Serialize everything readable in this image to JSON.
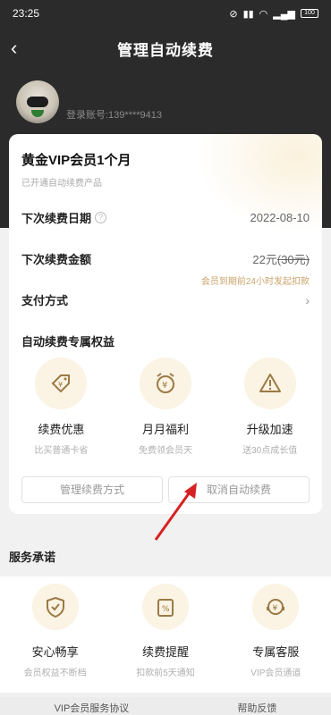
{
  "status_bar": {
    "time": "23:25",
    "battery": "100"
  },
  "nav": {
    "title": "管理自动续费",
    "back_icon": "chevron-left-icon"
  },
  "profile": {
    "account": "登录账号:139****9413"
  },
  "plan": {
    "title": "黄金VIP会员1个月",
    "subtitle": "已开通自动续费产品",
    "next_date_label": "下次续费日期",
    "next_date_value": "2022-08-10",
    "next_amount_label": "下次续费金额",
    "next_amount_value": "22元",
    "next_amount_original": "(30元)",
    "amount_note": "会员到期前24小时发起扣款",
    "payment_label": "支付方式",
    "benefits_title": "自动续费专属权益",
    "benefits": [
      {
        "icon": "discount-tag-icon",
        "name": "续费优惠",
        "desc": "比买普通卡省"
      },
      {
        "icon": "alarm-clock-yen-icon",
        "name": "月月福利",
        "desc": "免费领会员天"
      },
      {
        "icon": "warning-speed-icon",
        "name": "升级加速",
        "desc": "送30点成长值"
      }
    ],
    "manage_button": "管理续费方式",
    "cancel_button": "取消自动续费"
  },
  "promise": {
    "title": "服务承诺",
    "items": [
      {
        "icon": "shield-check-icon",
        "name": "安心畅享",
        "desc": "会员权益不断档"
      },
      {
        "icon": "calendar-percent-icon",
        "name": "续费提醒",
        "desc": "扣款前5天通知"
      },
      {
        "icon": "headset-yen-icon",
        "name": "专属客服",
        "desc": "VIP会员通道"
      }
    ]
  },
  "footer": {
    "left": "VIP会员服务协议",
    "right": "帮助反馈"
  },
  "colors": {
    "header": "#2b2b2b",
    "gold": "#c9a46a",
    "arrow": "#d62222"
  }
}
